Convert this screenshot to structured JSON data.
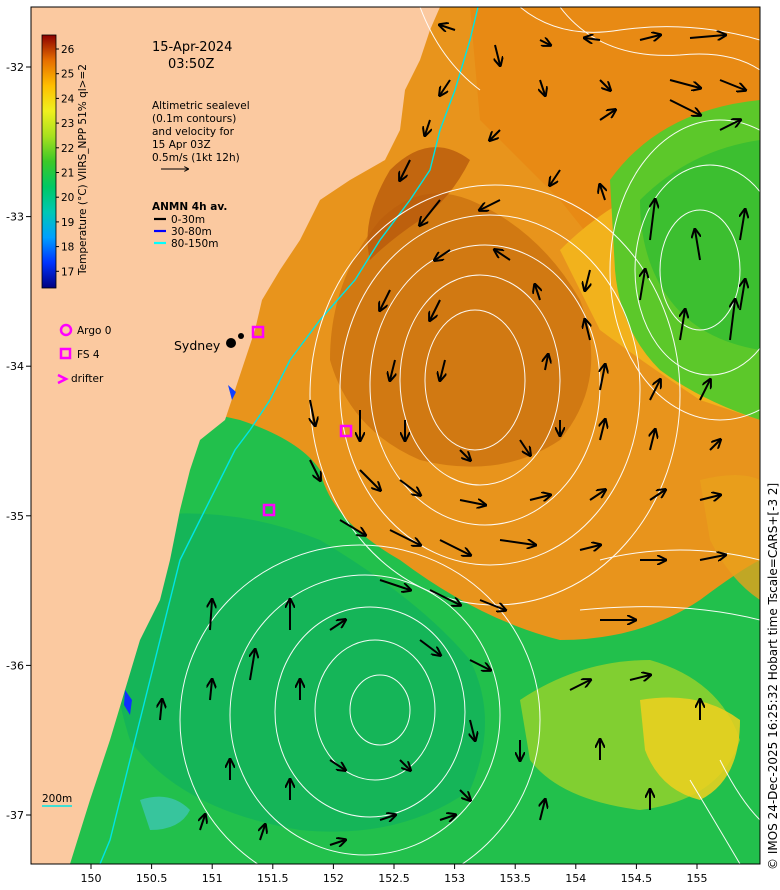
{
  "header": {
    "date": "15-Apr-2024",
    "time": "03:50Z"
  },
  "altimetry_note": {
    "lines": [
      "Altimetric sealevel",
      "(0.1m contours)",
      "and velocity for",
      "15 Apr 03Z",
      "0.5m/s (1kt 12h)"
    ]
  },
  "anmn": {
    "title": "ANMN 4h av.",
    "items": [
      {
        "label": "0-30m",
        "color": "#000000"
      },
      {
        "label": "30-80m",
        "color": "#0000ff"
      },
      {
        "label": "80-150m",
        "color": "#00ffff"
      }
    ]
  },
  "legend": {
    "argo": "Argo 0",
    "fs": "FS 4",
    "drifter": "drifter",
    "marker_color": "#ff00ff"
  },
  "city": {
    "name": "Sydney"
  },
  "isobath": {
    "label": "200m",
    "color": "#00e5e5"
  },
  "colorbar": {
    "label": "Temperature (°C) VIIRS_NPP 51% ql>=2",
    "ticks": [
      "26",
      "25",
      "24",
      "23",
      "22",
      "21",
      "20",
      "19",
      "18",
      "17"
    ],
    "colors": [
      "#00007f",
      "#0000ff",
      "#007fff",
      "#00bfbf",
      "#00cc66",
      "#22c222",
      "#66d01a",
      "#a0e01a",
      "#e6f01a",
      "#ffd000",
      "#ffa000",
      "#e67800",
      "#c85a00",
      "#a03c00",
      "#7f0000"
    ],
    "range": [
      16.5,
      26.5
    ]
  },
  "axes": {
    "lon_ticks": [
      "150",
      "150.5",
      "151",
      "151.5",
      "152",
      "152.5",
      "153",
      "153.5",
      "154",
      "154.5",
      "155"
    ],
    "lat_ticks": [
      "-32",
      "-33",
      "-34",
      "-35",
      "-36",
      "-37"
    ]
  },
  "credit": "© IMOS 24-Dec-2025 16:25:32 Hobart time Tscale=CARS+[-3 2]",
  "colors": {
    "land": "#fbc9a0",
    "warm_water": "#e89a1c",
    "cool_water": "#22c45a",
    "eddy_core": "#b8560c",
    "contour": "#ffffff",
    "arrow": "#000000"
  }
}
